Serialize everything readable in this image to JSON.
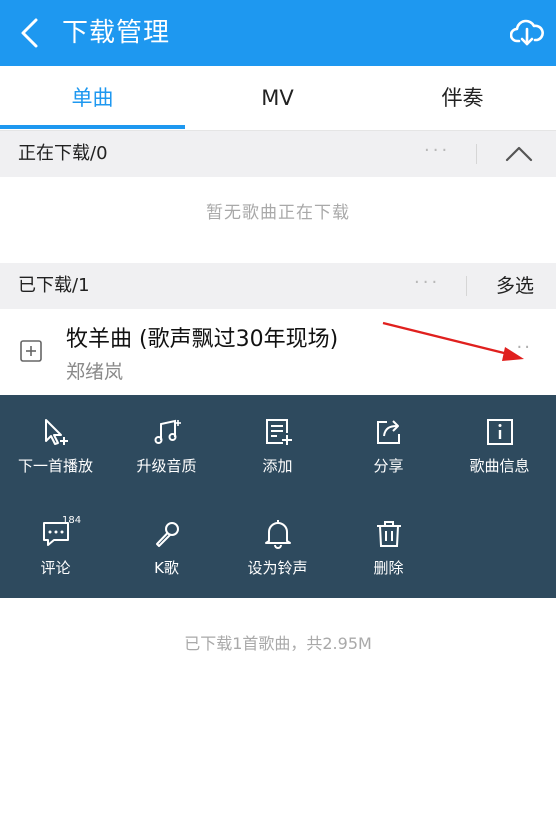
{
  "header": {
    "title": "下载管理"
  },
  "tabs": [
    {
      "label": "单曲"
    },
    {
      "label": "MV"
    },
    {
      "label": "伴奏"
    }
  ],
  "downloading": {
    "title": "正在下载/0",
    "empty_text": "暂无歌曲正在下载"
  },
  "downloaded": {
    "title": "已下载/1",
    "multi_select_label": "多选",
    "songs": [
      {
        "title": "牧羊曲 (歌声飘过30年现场)",
        "artist": "郑绪岚"
      }
    ]
  },
  "actions": [
    {
      "label": "下一首播放",
      "icon": "play-next-icon"
    },
    {
      "label": "升级音质",
      "icon": "music-quality-icon"
    },
    {
      "label": "添加",
      "icon": "add-to-list-icon"
    },
    {
      "label": "分享",
      "icon": "share-icon"
    },
    {
      "label": "歌曲信息",
      "icon": "info-icon"
    },
    {
      "label": "评论",
      "icon": "comment-icon",
      "badge": "184"
    },
    {
      "label": "K歌",
      "icon": "microphone-icon"
    },
    {
      "label": "设为铃声",
      "icon": "bell-icon"
    },
    {
      "label": "删除",
      "icon": "trash-icon"
    }
  ],
  "footer": {
    "summary": "已下载1首歌曲，共2.95M"
  },
  "colors": {
    "accent": "#1e98f0",
    "panel": "#2e4a5e",
    "annotation_arrow": "#e0201e"
  }
}
